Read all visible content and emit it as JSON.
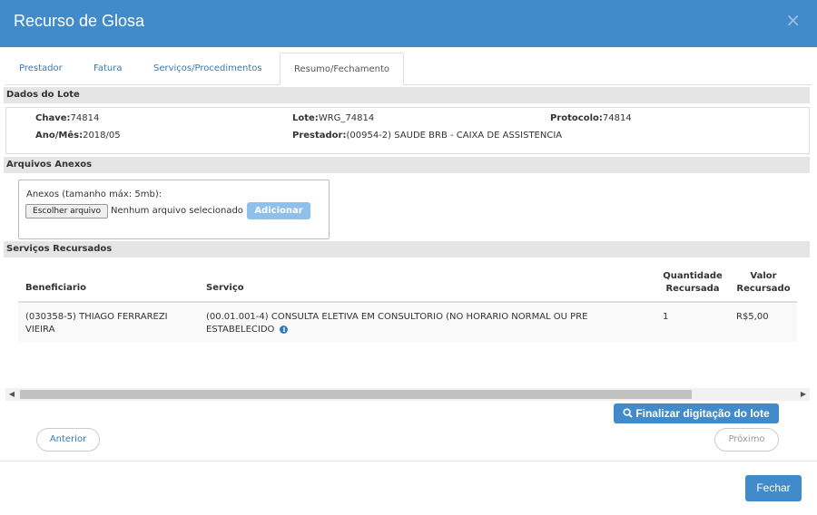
{
  "modal": {
    "title": "Recurso de Glosa",
    "close_symbol": "×"
  },
  "tabs": [
    {
      "label": "Prestador"
    },
    {
      "label": "Fatura"
    },
    {
      "label": "Serviços/Procedimentos"
    },
    {
      "label": "Resumo/Fechamento",
      "active": true
    }
  ],
  "lote": {
    "section_title": "Dados do Lote",
    "chave_label": "Chave:",
    "chave": "74814",
    "lote_label": "Lote:",
    "lote": "WRG_74814",
    "protocolo_label": "Protocolo:",
    "protocolo": "74814",
    "ano_mes_label": "Ano/Mês:",
    "ano_mes": "2018/05",
    "prestador_label": "Prestador:",
    "prestador": "(00954-2) SAUDE BRB - CAIXA DE ASSISTENCIA"
  },
  "anexos": {
    "section_title": "Arquivos Anexos",
    "label": "Anexos (tamanho máx: 5mb):",
    "choose_button": "Escolher arquivo",
    "no_file_text": "Nenhum arquivo selecionado",
    "add_button": "Adicionar"
  },
  "servicos": {
    "section_title": "Serviços Recursados",
    "columns": {
      "beneficiario": "Beneficiario",
      "servico": "Serviço",
      "quantidade_1": "Quantidade",
      "quantidade_2": "Recursada",
      "valor_1": "Valor",
      "valor_2": "Recursado"
    },
    "rows": [
      {
        "beneficiario_1": "(030358-5) THIAGO FERRAREZI",
        "beneficiario_2": "VIEIRA",
        "servico_1": "(00.01.001-4) CONSULTA ELETIVA EM CONSULTORIO (NO HORARIO NORMAL OU PRE",
        "servico_2": "ESTABELECIDO",
        "quantidade": "1",
        "valor": "R$5,00"
      }
    ]
  },
  "scroll_arrows": {
    "left": "◀",
    "right": "▶"
  },
  "actions": {
    "finalizar": "Finalizar digitação do lote",
    "anterior": "Anterior",
    "proximo": "Próximo",
    "fechar": "Fechar"
  },
  "colors": {
    "primary": "#428bca",
    "add_button": "#8ec0ee",
    "section_bg": "#e5e5e5"
  }
}
